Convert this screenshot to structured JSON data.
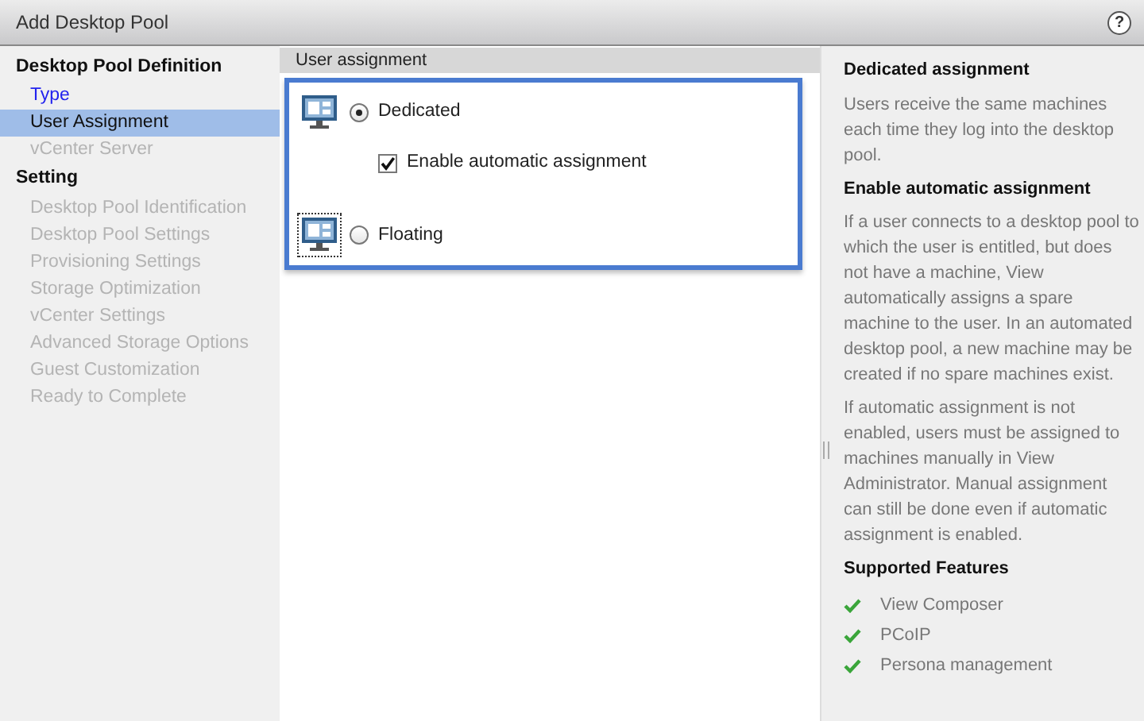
{
  "window": {
    "title": "Add Desktop Pool",
    "help": "?"
  },
  "sidebar": {
    "sections": [
      {
        "title": "Desktop Pool Definition",
        "items": [
          {
            "label": "Type",
            "selected": false,
            "disabled": false
          },
          {
            "label": "User Assignment",
            "selected": true,
            "disabled": false
          },
          {
            "label": "vCenter Server",
            "selected": false,
            "disabled": true
          }
        ]
      },
      {
        "title": "Setting",
        "items": [
          {
            "label": "Desktop Pool Identification",
            "selected": false,
            "disabled": true
          },
          {
            "label": "Desktop Pool Settings",
            "selected": false,
            "disabled": true
          },
          {
            "label": "Provisioning Settings",
            "selected": false,
            "disabled": true
          },
          {
            "label": "Storage Optimization",
            "selected": false,
            "disabled": true
          },
          {
            "label": "vCenter Settings",
            "selected": false,
            "disabled": true
          },
          {
            "label": "Advanced Storage Options",
            "selected": false,
            "disabled": true
          },
          {
            "label": "Guest Customization",
            "selected": false,
            "disabled": true
          },
          {
            "label": "Ready to Complete",
            "selected": false,
            "disabled": true
          }
        ]
      }
    ]
  },
  "main": {
    "header": "User assignment",
    "options": [
      {
        "label": "Dedicated",
        "selected": true,
        "focused": false,
        "sub_options": [
          {
            "label": "Enable automatic assignment",
            "checked": true
          }
        ]
      },
      {
        "label": "Floating",
        "selected": false,
        "focused": true
      }
    ]
  },
  "help_panel": {
    "blocks": [
      {
        "kind": "heading",
        "text": "Dedicated assignment"
      },
      {
        "kind": "paragraph",
        "text": "Users receive the same machines each time they log into the desktop pool."
      },
      {
        "kind": "heading",
        "text": "Enable automatic assignment"
      },
      {
        "kind": "paragraph",
        "text": "If a user connects to a desktop pool to which the user is entitled, but does not have a machine, View automatically assigns a spare machine to the user. In an automated desktop pool, a new machine may be created if no spare machines exist."
      },
      {
        "kind": "paragraph",
        "text": "If automatic assignment is not enabled, users must be assigned to machines manually in View Administrator. Manual assignment can still be done even if automatic assignment is enabled."
      },
      {
        "kind": "heading",
        "text": "Supported Features"
      },
      {
        "kind": "feature",
        "text": "View Composer"
      },
      {
        "kind": "feature",
        "text": "PCoIP"
      },
      {
        "kind": "feature",
        "text": "Persona management"
      }
    ]
  }
}
